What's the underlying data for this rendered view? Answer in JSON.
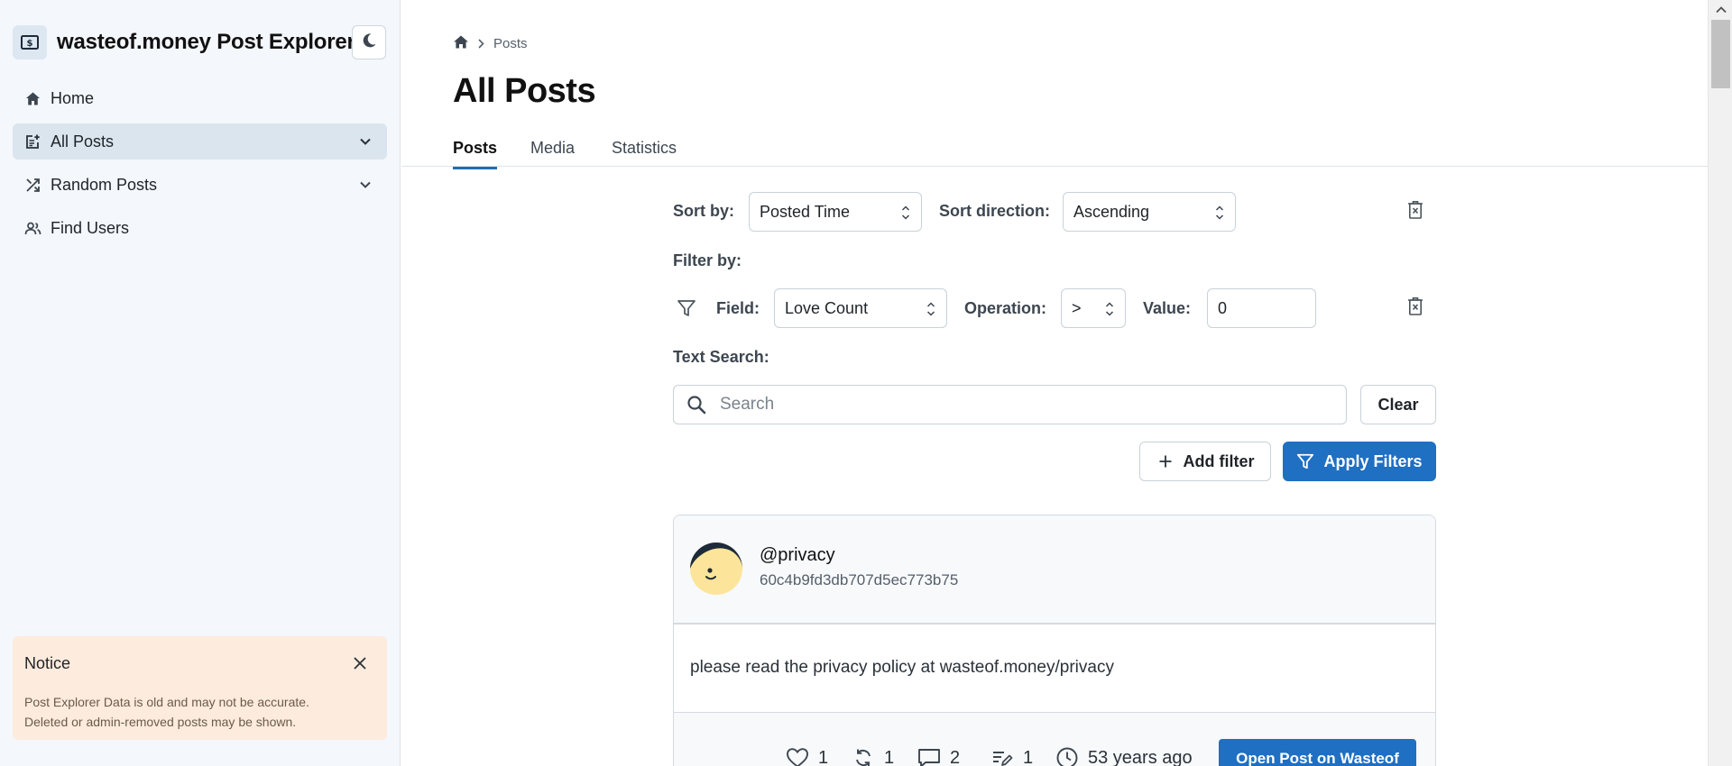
{
  "app": {
    "title": "wasteof.money Post Explorer"
  },
  "sidebar": {
    "items": [
      {
        "label": "Home",
        "icon": "home-icon"
      },
      {
        "label": "All Posts",
        "icon": "add-post-icon",
        "active": true,
        "expandable": true
      },
      {
        "label": "Random Posts",
        "icon": "shuffle-icon",
        "expandable": true
      },
      {
        "label": "Find Users",
        "icon": "users-icon"
      }
    ]
  },
  "notice": {
    "title": "Notice",
    "line1": "Post Explorer Data is old and may not be accurate.",
    "line2": "Deleted or admin-removed posts may be shown."
  },
  "breadcrumb": {
    "current": "Posts"
  },
  "page": {
    "title": "All Posts"
  },
  "tabs": [
    {
      "label": "Posts",
      "active": true
    },
    {
      "label": "Media"
    },
    {
      "label": "Statistics"
    }
  ],
  "sort": {
    "label": "Sort by:",
    "value": "Posted Time",
    "direction_label": "Sort direction:",
    "direction_value": "Ascending"
  },
  "filter": {
    "title": "Filter by:",
    "field_label": "Field:",
    "field_value": "Love Count",
    "operation_label": "Operation:",
    "operation_value": ">",
    "value_label": "Value:",
    "value": "0"
  },
  "text_search": {
    "label": "Text Search:",
    "placeholder": "Search",
    "clear_label": "Clear"
  },
  "actions": {
    "add_filter": "Add filter",
    "apply_filters": "Apply Filters"
  },
  "post": {
    "username": "@privacy",
    "id": "60c4b9fd3db707d5ec773b75",
    "text": "please read the privacy policy at wasteof.money/privacy",
    "loves": "1",
    "reposts": "1",
    "comments": "2",
    "revisions": "1",
    "time": "53 years ago",
    "open_label": "Open Post on Wasteof"
  },
  "colors": {
    "accent": "#1f6fc2",
    "sidebar_bg": "#f4f7fb",
    "active_nav": "#dbe5ee",
    "notice_bg": "#fdebdd"
  }
}
